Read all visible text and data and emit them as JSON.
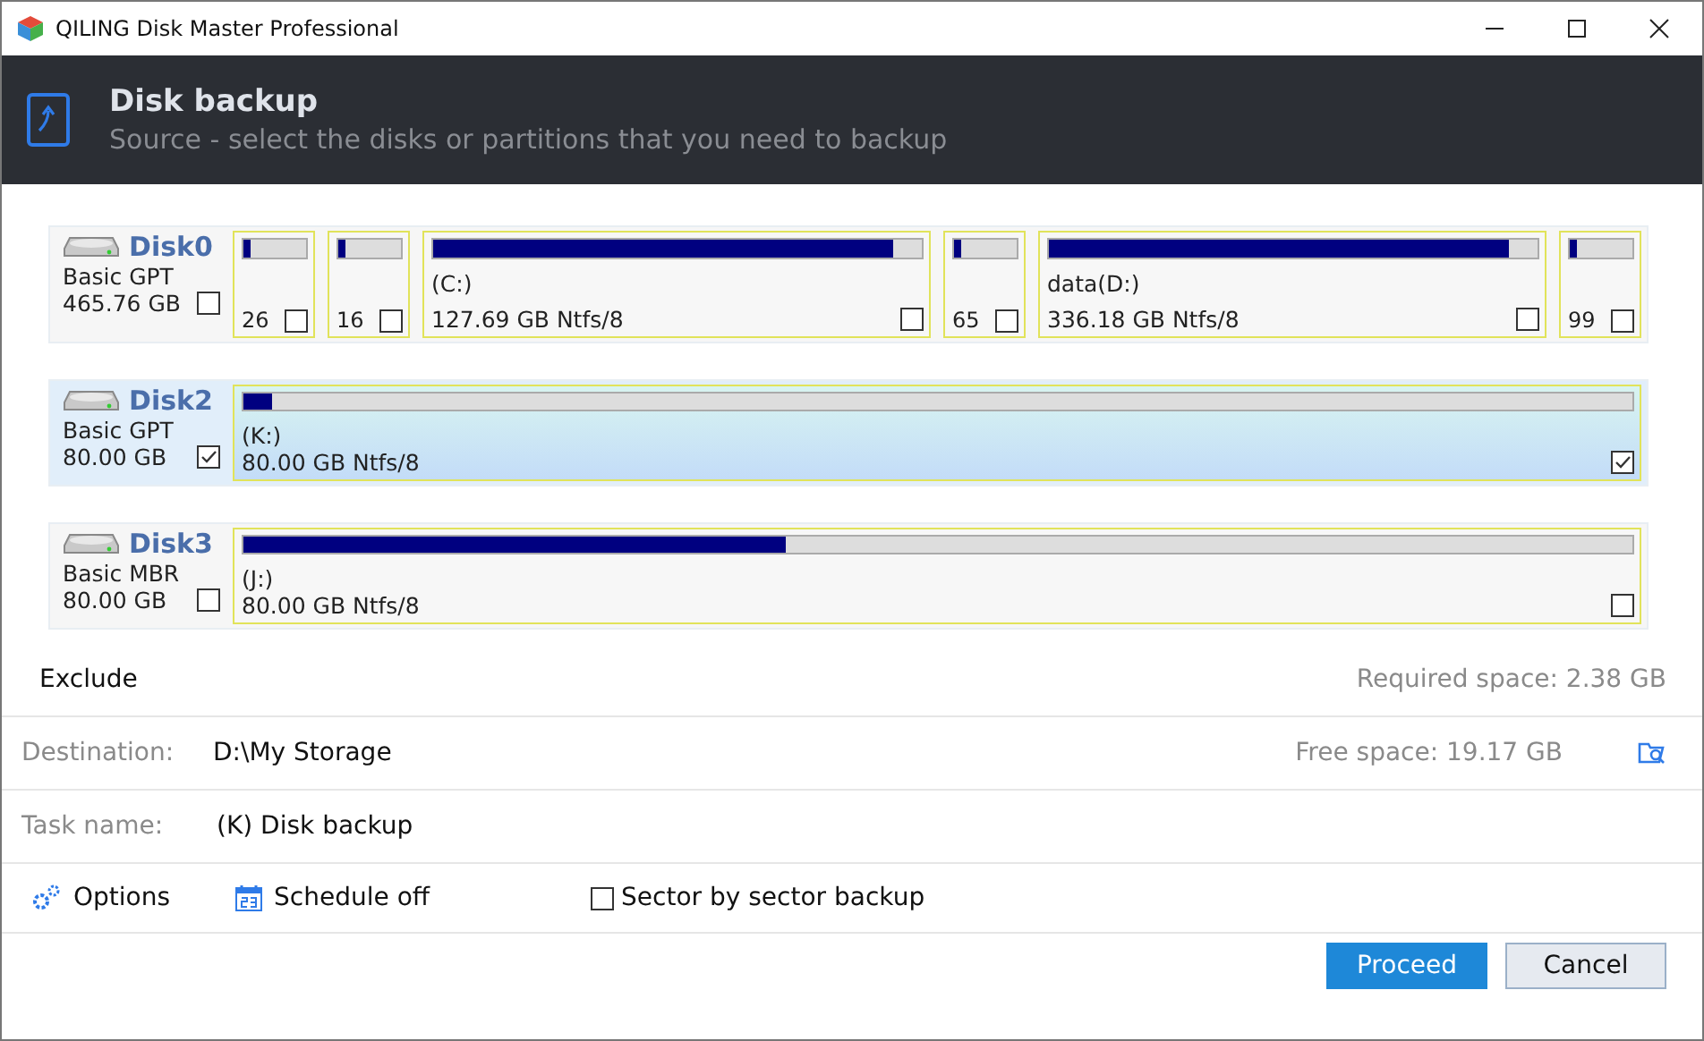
{
  "window": {
    "title": "QILING Disk Master Professional"
  },
  "header": {
    "title": "Disk backup",
    "subtitle": "Source - select the disks or partitions that you need to backup"
  },
  "disks": [
    {
      "name": "Disk0",
      "type": "Basic GPT",
      "size": "465.76 GB",
      "checked": false,
      "selected": false,
      "partitions": [
        {
          "kind": "small",
          "info": "26",
          "level": 0.12,
          "checked": false
        },
        {
          "kind": "small",
          "info": "16",
          "level": 0.12,
          "checked": false
        },
        {
          "kind": "large",
          "label": "(C:)",
          "info": "127.69 GB Ntfs/8",
          "level": 0.94,
          "checked": false
        },
        {
          "kind": "small",
          "info": "65",
          "level": 0.12,
          "checked": false
        },
        {
          "kind": "large",
          "label": "data(D:)",
          "info": "336.18 GB Ntfs/8",
          "level": 0.94,
          "checked": false
        },
        {
          "kind": "small",
          "info": "99",
          "level": 0.12,
          "checked": false
        }
      ]
    },
    {
      "name": "Disk2",
      "type": "Basic GPT",
      "size": "80.00 GB",
      "checked": true,
      "selected": true,
      "partitions": [
        {
          "kind": "large",
          "label": "(K:)",
          "info": "80.00 GB Ntfs/8",
          "level": 0.02,
          "checked": true
        }
      ]
    },
    {
      "name": "Disk3",
      "type": "Basic MBR",
      "size": "80.00 GB",
      "checked": false,
      "selected": false,
      "partitions": [
        {
          "kind": "large",
          "label": "(J:)",
          "info": "80.00 GB Ntfs/8",
          "level": 0.39,
          "checked": false
        }
      ]
    }
  ],
  "exclude": {
    "label": "Exclude",
    "required": "Required space: 2.38 GB"
  },
  "destination": {
    "label": "Destination:",
    "value": "D:\\My Storage",
    "free": "Free space: 19.17 GB"
  },
  "task": {
    "label": "Task name:",
    "value": "(K) Disk backup"
  },
  "options": {
    "options": "Options",
    "schedule": "Schedule off",
    "sector": {
      "label": "Sector by sector backup",
      "checked": false
    }
  },
  "buttons": {
    "proceed": "Proceed",
    "cancel": "Cancel"
  }
}
